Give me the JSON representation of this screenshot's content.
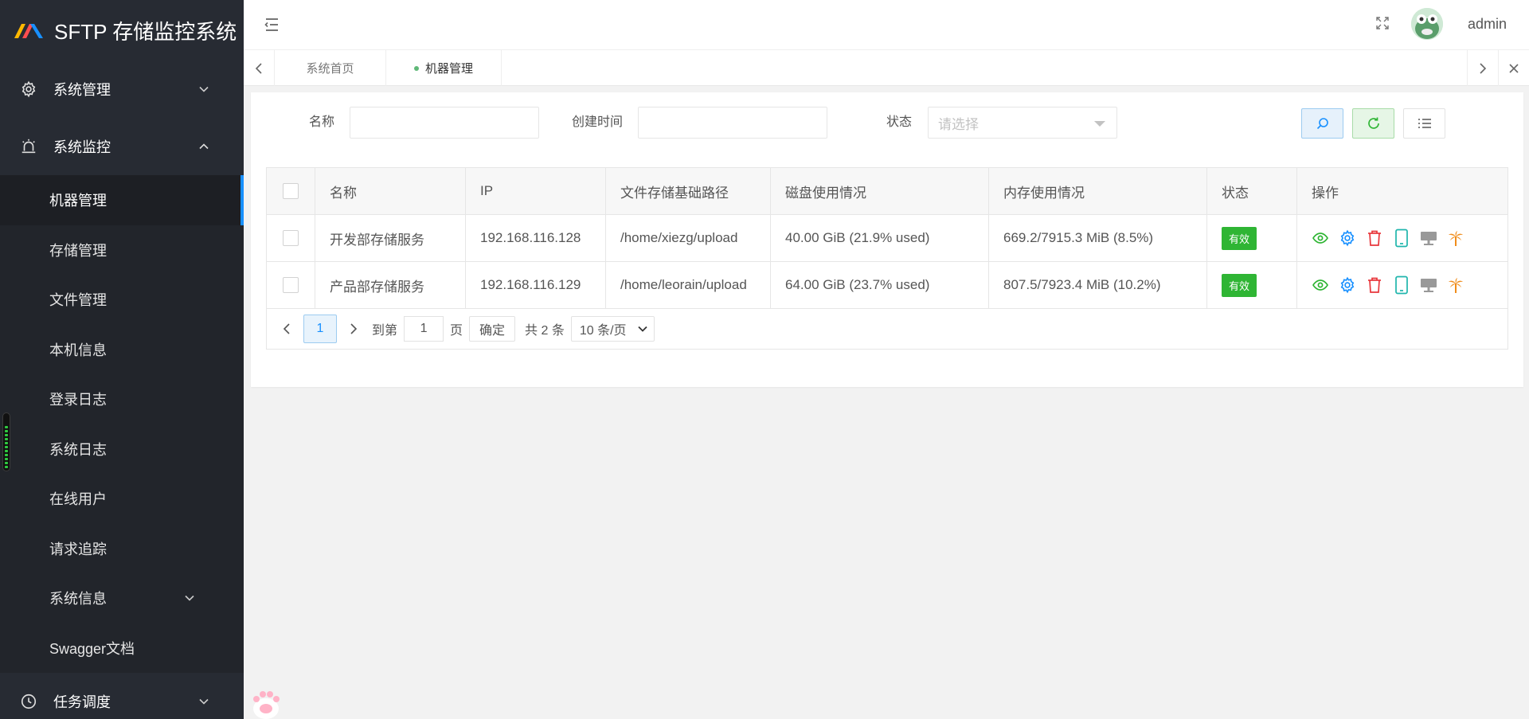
{
  "app": {
    "title": "SFTP 存储监控系统",
    "brand_colors": [
      "#ff4d4f",
      "#ffb800",
      "#1890ff"
    ]
  },
  "sidebar": {
    "groups": [
      {
        "label": "系统管理",
        "icon": "gear-icon",
        "expanded": false
      },
      {
        "label": "系统监控",
        "icon": "alarm-icon",
        "expanded": true
      },
      {
        "label": "任务调度",
        "icon": "clock-icon",
        "expanded": false
      }
    ],
    "items": [
      {
        "label": "机器管理",
        "active": true
      },
      {
        "label": "存储管理"
      },
      {
        "label": "文件管理"
      },
      {
        "label": "本机信息"
      },
      {
        "label": "登录日志"
      },
      {
        "label": "系统日志"
      },
      {
        "label": "在线用户"
      },
      {
        "label": "请求追踪"
      },
      {
        "label": "系统信息",
        "has_children": true
      },
      {
        "label": "Swagger文档"
      }
    ]
  },
  "header": {
    "username": "admin"
  },
  "tabs": [
    {
      "label": "系统首页",
      "active": false
    },
    {
      "label": "机器管理",
      "active": true
    }
  ],
  "filters": {
    "name_label": "名称",
    "name_value": "",
    "created_label": "创建时间",
    "created_value": "",
    "status_label": "状态",
    "status_placeholder": "请选择"
  },
  "table": {
    "columns": [
      "名称",
      "IP",
      "文件存储基础路径",
      "磁盘使用情况",
      "内存使用情况",
      "状态",
      "操作"
    ],
    "rows": [
      {
        "name": "开发部存储服务",
        "ip": "192.168.116.128",
        "path": "/home/xiezg/upload",
        "disk": "40.00 GiB (21.9% used)",
        "memory": "669.2/7915.3 MiB (8.5%)",
        "status": "有效"
      },
      {
        "name": "产品部存储服务",
        "ip": "192.168.116.129",
        "path": "/home/leorain/upload",
        "disk": "64.00 GiB (23.7% used)",
        "memory": "807.5/7923.4 MiB (10.2%)",
        "status": "有效"
      }
    ],
    "row_actions": [
      "eye-icon",
      "gear-icon",
      "trash-icon",
      "mobile-icon",
      "monitor-icon",
      "palm-icon"
    ]
  },
  "pagination": {
    "current_page": "1",
    "goto_label": "到第",
    "goto_value": "1",
    "page_label": "页",
    "confirm_label": "确定",
    "total_label": "共 2 条",
    "page_size_label": "10 条/页"
  },
  "colors": {
    "sidebar_bg": "#272b33",
    "active_accent": "#1890ff",
    "status_green": "#2fb534"
  }
}
